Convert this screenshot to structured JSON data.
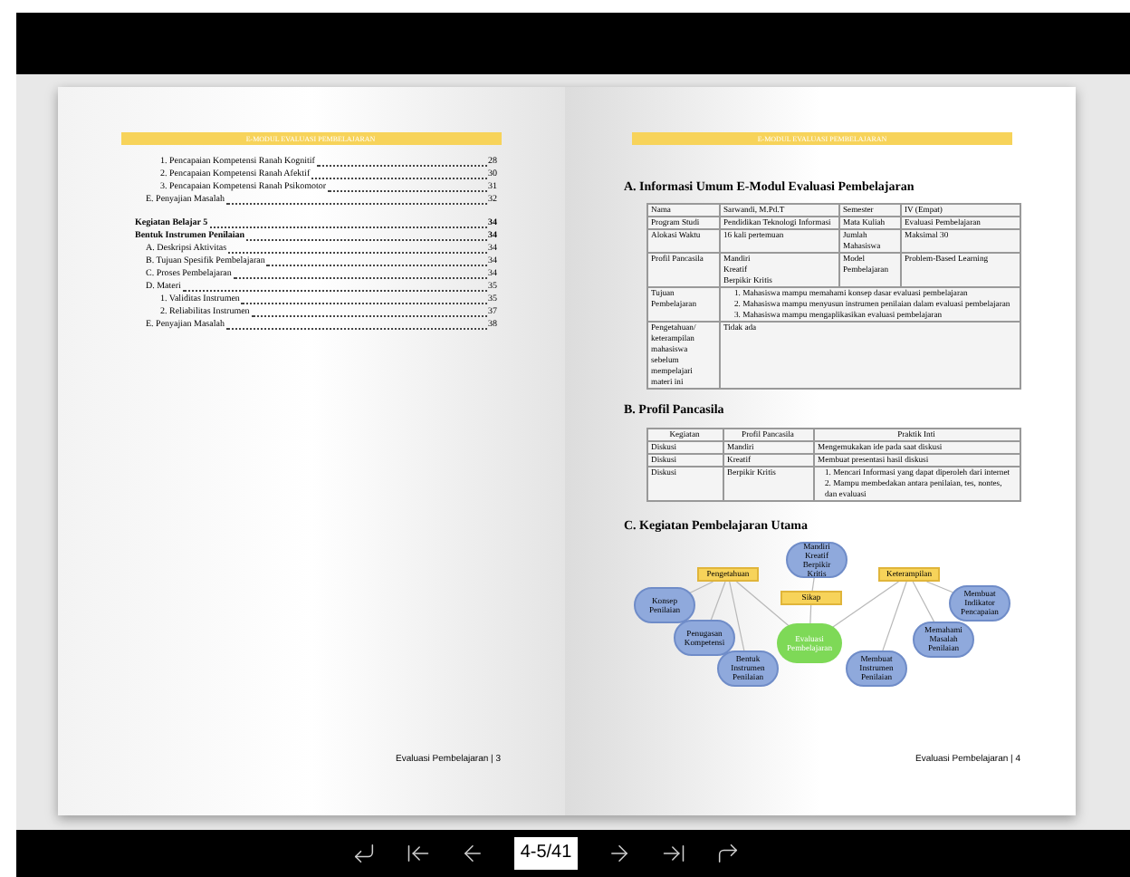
{
  "left_page": {
    "header": "E-MODUL EVALUASI PEMBELAJARAN",
    "toc": [
      {
        "kind": "subitem",
        "label": "1. Pencapaian Kompetensi Ranah Kognitif",
        "page": "28"
      },
      {
        "kind": "subitem",
        "label": "2. Pencapaian Kompetensi Ranah Afektif",
        "page": "30"
      },
      {
        "kind": "subitem",
        "label": "3. Pencapaian Kompetensi Ranah Psikomotor",
        "page": "31"
      },
      {
        "kind": "item",
        "label": "E. Penyajian Masalah",
        "page": "32"
      },
      {
        "kind": "heading",
        "label": "Kegiatan Belajar 5",
        "page": "34"
      },
      {
        "kind": "heading",
        "label": "Bentuk Instrumen Penilaian",
        "page": "34"
      },
      {
        "kind": "item",
        "label": "A. Deskripsi Aktivitas",
        "page": "34"
      },
      {
        "kind": "item",
        "label": "B. Tujuan Spesifik Pembelajaran",
        "page": "34"
      },
      {
        "kind": "item",
        "label": "C. Proses Pembelajaran",
        "page": "34"
      },
      {
        "kind": "item",
        "label": "D. Materi",
        "page": "35",
        "children": [
          {
            "kind": "item",
            "label": "1. Validitas Instrumen",
            "page": "35"
          },
          {
            "kind": "item",
            "label": "2. Reliabilitas Instrumen",
            "page": "37"
          }
        ]
      },
      {
        "kind": "item",
        "label": "E. Penyajian Masalah",
        "page": "38"
      }
    ],
    "footer": "Evaluasi Pembelajaran | 3"
  },
  "right_page": {
    "header": "E-MODUL EVALUASI PEMBELAJARAN",
    "section_a": {
      "title": "A. Informasi Umum E-Modul Evaluasi Pembelajaran",
      "rows": [
        {
          "cells": [
            "Nama",
            "Sarwandi, M.Pd.T",
            "Semester",
            "IV (Empat)"
          ]
        },
        {
          "cells": [
            "Program Studi",
            "Pendidikan Teknologi Informasi",
            "Mata Kuliah",
            "Evaluasi Pembelajaran"
          ]
        },
        {
          "cells": [
            "Alokasi Waktu",
            "16 kali pertemuan",
            "Jumlah Mahasiswa",
            "Maksimal 30"
          ]
        },
        {
          "cells": [
            "Profil Pancasila",
            "Mandiri\nKreatif\nBerpikir Kritis",
            "Model Pembelajaran",
            "Problem-Based Learning"
          ]
        },
        {
          "cells": [
            "Tujuan Pembelajaran"
          ],
          "list": [
            "1. Mahasiswa mampu memahami konsep dasar evaluasi pembelajaran",
            "2. Mahasiswa mampu menyusun instrumen penilaian dalam evaluasi pembelajaran",
            "3. Mahasiswa mampu mengaplikasikan evaluasi pembelajaran"
          ]
        },
        {
          "cells": [
            "Pengetahuan/ keterampilan mahasiswa sebelum mempelajari materi ini",
            {
              "text": "Tidak ada",
              "colspan": 3
            }
          ]
        }
      ]
    },
    "section_b": {
      "title": "B. Profil Pancasila",
      "columns": [
        "Kegiatan",
        "Profil Pancasila",
        "Praktik Inti"
      ],
      "rows": [
        {
          "cells": [
            "Diskusi",
            "Mandiri",
            "Mengemukakan ide pada saat diskusi"
          ]
        },
        {
          "cells": [
            "Diskusi",
            "Kreatif",
            "Membuat presentasi hasil diskusi"
          ]
        },
        {
          "cells": [
            "Diskusi",
            "Berpikir Kritis"
          ],
          "list": [
            "1. Mencari Informasi yang dapat diperoleh dari internet",
            "2. Mampu membedakan antara penilaian, tes, nontes, dan evaluasi"
          ]
        }
      ]
    },
    "section_c": {
      "title": "C. Kegiatan Pembelajaran Utama",
      "nodes": [
        {
          "kind": "rect",
          "label": "Pengetahuan"
        },
        {
          "kind": "ellipse",
          "label": "Mandiri Kreatif Berpikir Kritis"
        },
        {
          "kind": "rect",
          "label": "Keterampilan"
        },
        {
          "kind": "ellipse",
          "label": "Konsep Penilaian"
        },
        {
          "kind": "rect",
          "label": "Sikap"
        },
        {
          "kind": "ellipse",
          "label": "Membuat Indikator Pencapaian"
        },
        {
          "kind": "ellipse",
          "label": "Penugasan Kompetensi"
        },
        {
          "kind": "center",
          "label": "Evaluasi Pembelajaran"
        },
        {
          "kind": "ellipse",
          "label": "Memahami Masalah Penilaian"
        },
        {
          "kind": "ellipse",
          "label": "Bentuk Instrumen Penilaian"
        },
        {
          "kind": "ellipse",
          "label": "Membuat Instrumen Penilaian"
        }
      ]
    },
    "footer": "Evaluasi Pembelajaran | 4"
  },
  "navigation": {
    "page_field": "4-5/41"
  }
}
